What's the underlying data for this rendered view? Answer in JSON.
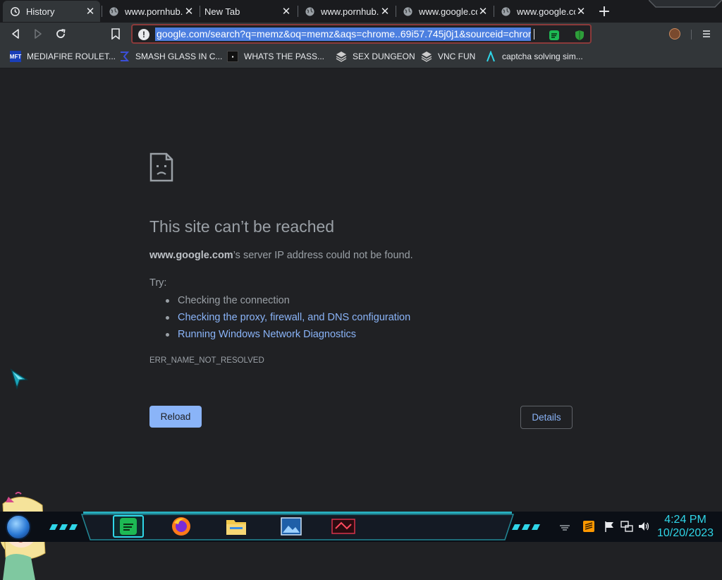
{
  "tabs": [
    {
      "title": "History",
      "icon": "history-icon",
      "active": true
    },
    {
      "title": "www.pornhub.c",
      "icon": "globe-icon",
      "active": false
    },
    {
      "title": "New Tab",
      "icon": "none",
      "active": false
    },
    {
      "title": "www.pornhub.c",
      "icon": "globe-icon",
      "active": false
    },
    {
      "title": "www.google.co",
      "icon": "globe-icon",
      "active": false
    },
    {
      "title": "www.google.co",
      "icon": "globe-icon",
      "active": false
    }
  ],
  "omnibox": {
    "url": "google.com/search?q=memz&oq=memz&aqs=chrome..69i57.745j0j1&sourceid=chrom",
    "selected": true,
    "border_color": "#8b3a3a",
    "selection_color": "#4c7fe0"
  },
  "bookmarks": [
    {
      "label": "MEDIAFIRE ROULET...",
      "icon": "mft-icon",
      "color": "#1a3fb8"
    },
    {
      "label": "SMASH GLASS IN C...",
      "icon": "sigma-icon",
      "color": "#3b4fd8"
    },
    {
      "label": "WHATS THE PASS...",
      "icon": "terminal-icon",
      "color": "#111111"
    },
    {
      "label": "SEX DUNGEON",
      "icon": "stack-icon",
      "color": "#cccccc"
    },
    {
      "label": "VNC FUN",
      "icon": "stack-icon",
      "color": "#cccccc"
    },
    {
      "label": "captcha solving sim...",
      "icon": "lambda-icon",
      "color": "#2fd6e8"
    }
  ],
  "error": {
    "title": "This site can’t be reached",
    "host": "www.google.com",
    "desc_suffix": "’s server IP address could not be found.",
    "try_label": "Try:",
    "suggestions": [
      {
        "text": "Checking the connection",
        "link": false
      },
      {
        "text": "Checking the proxy, firewall, and DNS configuration",
        "link": true
      },
      {
        "text": "Running Windows Network Diagnostics",
        "link": true
      }
    ],
    "code": "ERR_NAME_NOT_RESOLVED",
    "reload_label": "Reload",
    "details_label": "Details"
  },
  "taskbar": {
    "time": "4:24 PM",
    "date": "10/20/2023",
    "apps": [
      "spotify-icon",
      "firefox-icon",
      "file-explorer-icon",
      "photos-icon",
      "game-icon"
    ],
    "tray": [
      "sublime-icon",
      "flag-icon",
      "network-icon",
      "volume-icon"
    ],
    "accent": "#2fd6e8"
  },
  "colors": {
    "page_bg": "#202124",
    "toolbar_bg": "#323639",
    "link": "#8ab4f8",
    "muted_text": "#9aa0a6"
  }
}
